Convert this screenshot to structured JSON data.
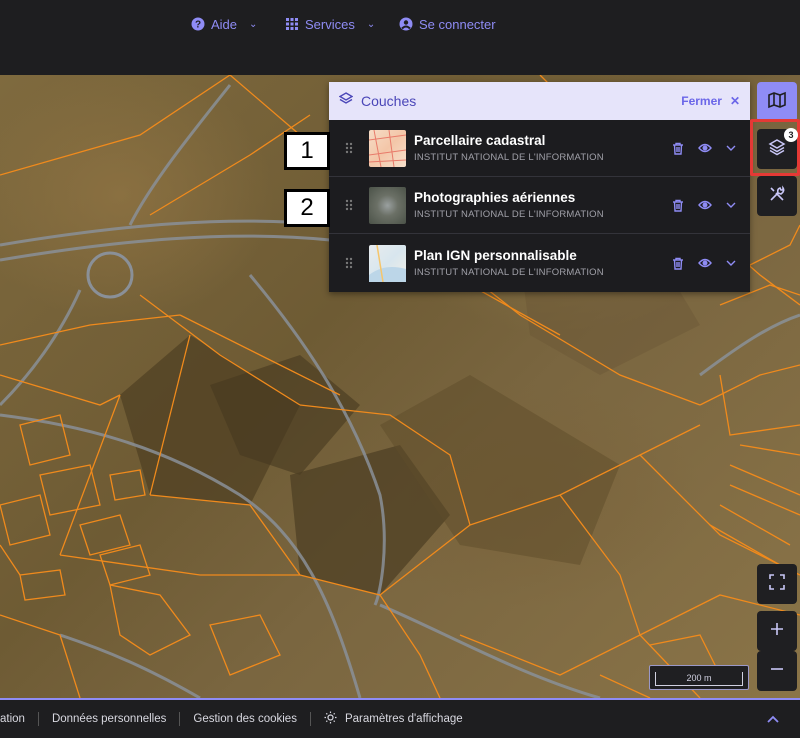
{
  "topbar": {
    "help_label": "Aide",
    "services_label": "Services",
    "login_label": "Se connecter"
  },
  "layers_panel": {
    "title": "Couches",
    "close_label": "Fermer",
    "layers": [
      {
        "name": "Parcellaire cadastral",
        "source": "INSTITUT NATIONAL DE L'INFORMATION"
      },
      {
        "name": "Photographies aériennes",
        "source": "INSTITUT NATIONAL DE L'INFORMATION"
      },
      {
        "name": "Plan IGN personnalisable",
        "source": "INSTITUT NATIONAL DE L'INFORMATION"
      }
    ]
  },
  "callouts": [
    "1",
    "2"
  ],
  "layers_badge": "3",
  "scale_label": "200 m",
  "footer": {
    "item_truncated": "ation",
    "personal_data": "Données personnelles",
    "cookies": "Gestion des cookies",
    "display_settings": "Paramètres d'affichage"
  },
  "colors": {
    "accent": "#8f8cf5",
    "highlight": "#e53935",
    "parcel_lines": "#f08a1c"
  }
}
